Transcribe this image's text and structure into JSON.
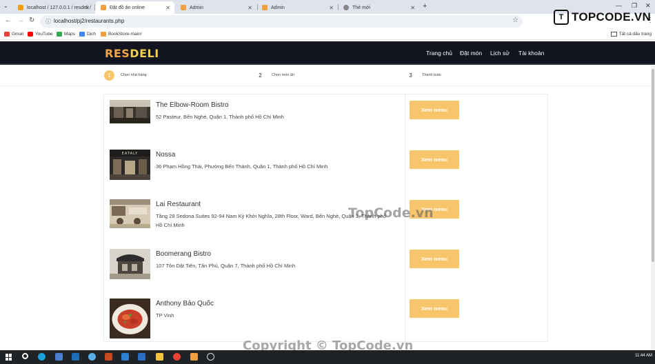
{
  "browser": {
    "tabs": [
      {
        "title": "localhost / 127.0.0.1 / resdeli /",
        "favicon_color": "#f39c12"
      },
      {
        "title": "Đặt đồ ăn online",
        "favicon_color": "#f0a040"
      },
      {
        "title": "Admin",
        "favicon_color": "#f0a040"
      },
      {
        "title": "Admin",
        "favicon_color": "#f0a040"
      },
      {
        "title": "Thẻ mới",
        "favicon_color": "#888888"
      }
    ],
    "url": "localhost/pj2/restaurants.php",
    "bookmarks": [
      {
        "label": "Gmail",
        "color": "#ea4335"
      },
      {
        "label": "YouTube",
        "color": "#ff0000"
      },
      {
        "label": "Maps",
        "color": "#34a853"
      },
      {
        "label": "Dịch",
        "color": "#4285f4"
      },
      {
        "label": "BookStore-main/",
        "color": "#f0a040"
      }
    ],
    "all_bookmarks": "Tất cả dấu trang",
    "brand_logo_text": "TOPCODE.VN"
  },
  "site": {
    "logo_part1": "RES",
    "logo_part2": "DELI",
    "nav": [
      "Trang chủ",
      "Đặt món",
      "Lịch sử",
      "Tài khoản"
    ]
  },
  "steps": [
    {
      "num": "1",
      "label": "Chọn nhà hàng"
    },
    {
      "num": "2",
      "label": "Chọn món ăn"
    },
    {
      "num": "3",
      "label": "Thanh toán"
    }
  ],
  "restaurants": [
    {
      "name": "The Elbow-Room Bistro",
      "address": "52 Pasteur, Bến Nghé, Quận 1, Thành phố Hồ Chí Minh",
      "button": "Xem menu"
    },
    {
      "name": "Nossa",
      "address": "36 Phạm Hồng Thái, Phường Bến Thành, Quận 1, Thành phố Hồ Chí Minh",
      "button": "Xem menu",
      "sign": "EATALY"
    },
    {
      "name": "Lai Restaurant",
      "address": "Tầng 28 Sedona Suites 92-94 Nam Kỳ Khởi Nghĩa, 28th Floor, Ward, Bến Nghé, Quận 1, Thành phố Hồ Chí Minh",
      "button": "Xem menu"
    },
    {
      "name": "Boomerang Bistro",
      "address": "107 Tôn Dật Tiên, Tân Phú, Quận 7, Thành phố Hồ Chí Minh",
      "button": "Xem menu"
    },
    {
      "name": "Anthony Bảo Quốc",
      "address": "TP Vinh",
      "button": "Xem menu"
    }
  ],
  "watermark": "TopCode.vn",
  "copyright": "Copyright © TopCode.vn",
  "taskbar": {
    "time": "11:44 AM"
  }
}
